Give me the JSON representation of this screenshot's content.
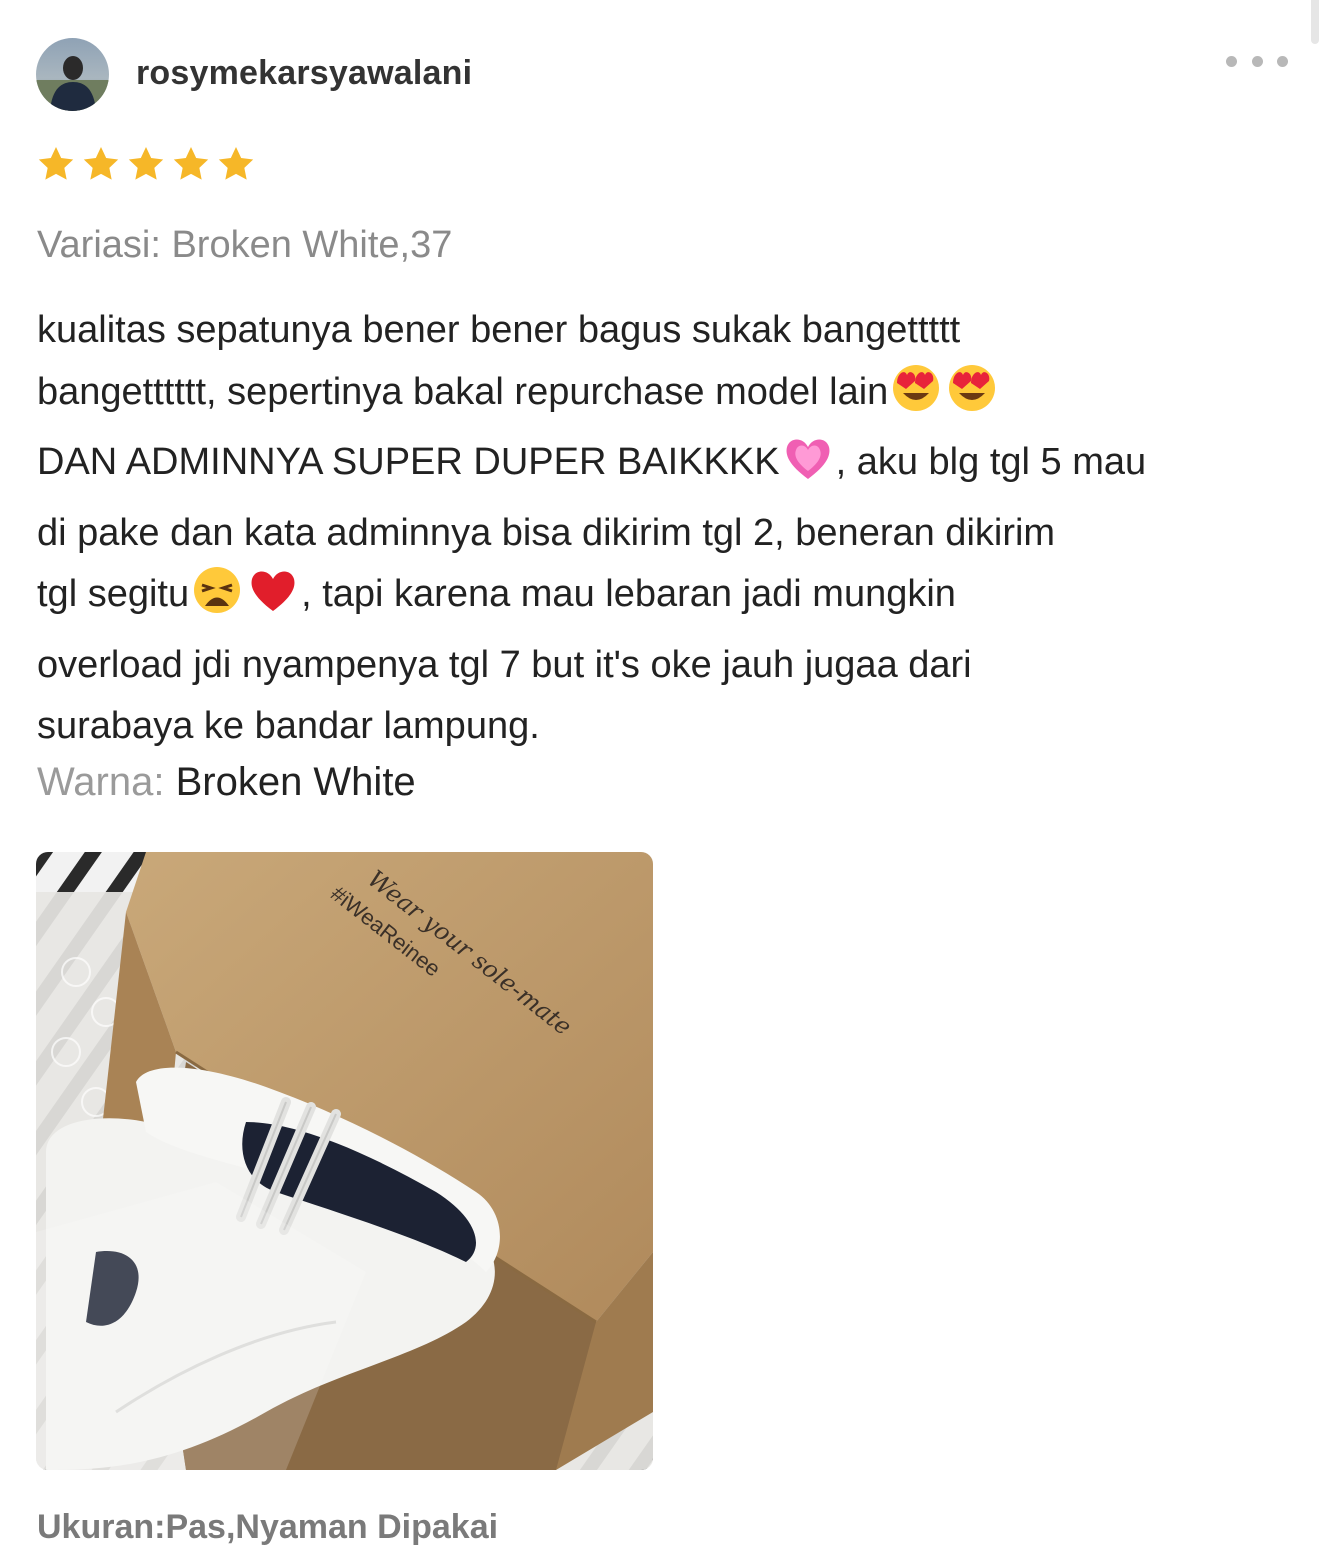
{
  "review": {
    "username": "rosymekarsyawalani",
    "rating": 5,
    "max_rating": 5,
    "variant_text": "Variasi: Broken White,37",
    "body_lines": [
      "kualitas sepatunya bener bener bagus sukak bangettttt",
      "bangetttttt, sepertinya bakal repurchase model lain",
      "DAN ADMINNYA SUPER DUPER BAIKKKK",
      ", aku blg tgl 5 mau",
      "di pake dan kata adminnya bisa dikirim tgl 2, beneran dikirim",
      "tgl segitu",
      ", tapi karena mau lebaran jadi mungkin",
      "overload jdi nyampenya tgl 7 but it's oke jauh jugaa dari",
      "surabaya ke bandar lampung."
    ],
    "emojis": [
      "heart-eyes-emoji",
      "heart-eyes-emoji",
      "growing-heart-emoji",
      "weary-face-emoji",
      "red-heart-emoji"
    ],
    "color_label": "Warna:",
    "color_value": "Broken White",
    "photo_texts": {
      "line1": "Wear your sole-mate",
      "line2": "#iWeaReinee"
    },
    "size_text": "Ukuran:Pas,Nyaman Dipakai"
  },
  "theme": {
    "star_color": "#F6B728",
    "muted_text": "#8a8a8a",
    "body_text": "#222222"
  },
  "icons": [
    "more-options-icon",
    "star-icon",
    "avatar"
  ]
}
